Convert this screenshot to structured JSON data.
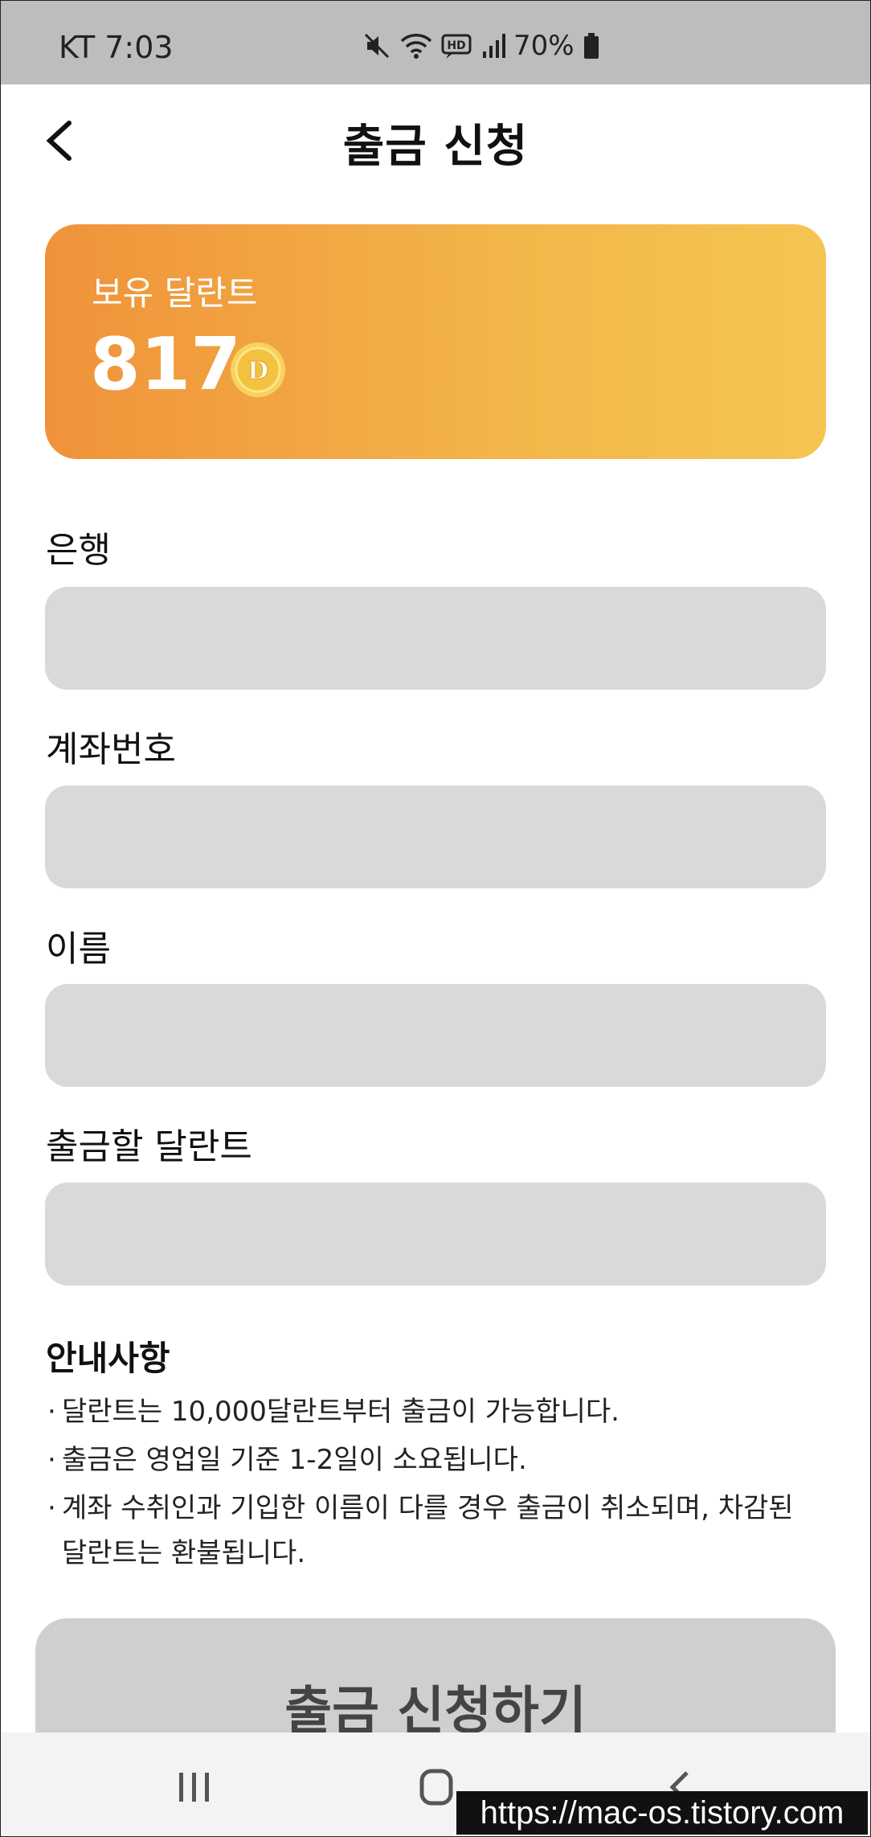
{
  "status_bar": {
    "carrier_time": "KT 7:03",
    "network": "HD",
    "battery": "70%"
  },
  "header": {
    "title": "출금 신청"
  },
  "balance": {
    "label": "보유 달란트",
    "value": "817",
    "coin_letter": "D"
  },
  "form": {
    "bank_label": "은행",
    "bank_value": "",
    "account_label": "계좌번호",
    "account_value": "",
    "name_label": "이름",
    "name_value": "",
    "amount_label": "출금할 달란트",
    "amount_value": ""
  },
  "notice": {
    "title": "안내사항",
    "bullet": "·",
    "items": [
      "달란트는 10,000달란트부터 출금이 가능합니다.",
      "출금은 영업일 기준 1-2일이 소요됩니다.",
      "계좌 수취인과 기입한 이름이 다를 경우 출금이 취소되며, 차감된 달란트는 환불됩니다."
    ]
  },
  "submit": {
    "label": "출금 신청하기"
  },
  "watermark": "https://mac-os.tistory.com",
  "colors": {
    "card_start": "#f0923a",
    "card_end": "#f5c551",
    "input_bg": "#d9d9d9",
    "button_bg": "#cfcfcf",
    "status_bar_bg": "#bdbdbd"
  }
}
